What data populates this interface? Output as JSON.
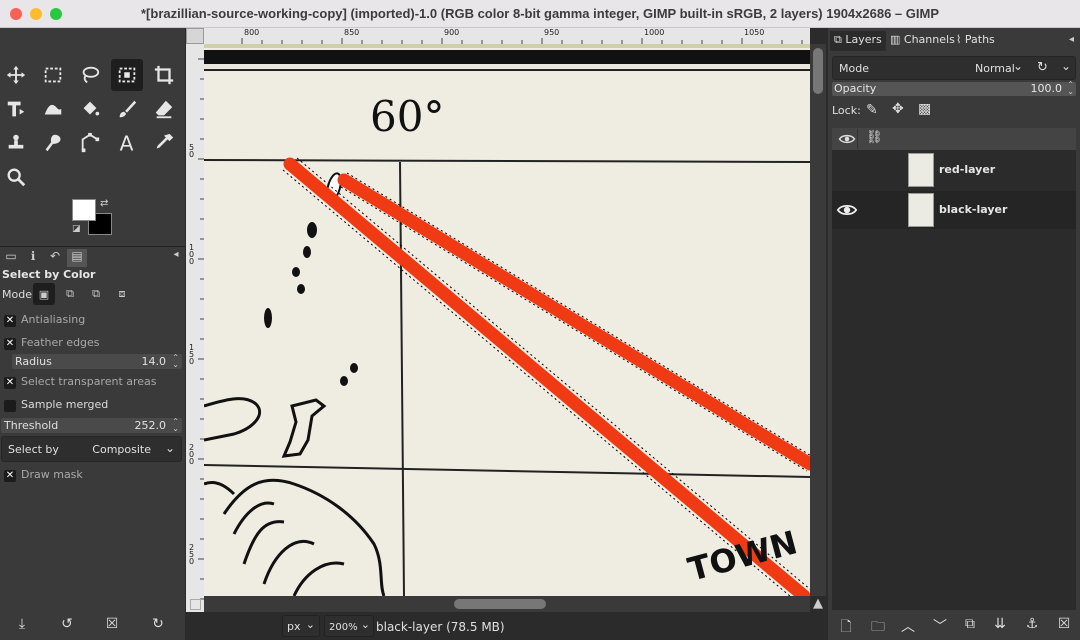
{
  "window": {
    "title": "*[brazillian-source-working-copy] (imported)-1.0 (RGB color 8-bit gamma integer, GIMP built-in sRGB, 2 layers) 1904x2686 – GIMP"
  },
  "tool_options": {
    "title": "Select by Color",
    "mode_label": "Mode:",
    "antialiasing": {
      "label": "Antialiasing",
      "checked": true
    },
    "feather_edges": {
      "label": "Feather edges",
      "checked": true
    },
    "radius": {
      "label": "Radius",
      "value": "14.0"
    },
    "select_transparent": {
      "label": "Select transparent areas",
      "checked": true
    },
    "sample_merged": {
      "label": "Sample merged",
      "checked": false
    },
    "threshold": {
      "label": "Threshold",
      "value": "252.0"
    },
    "select_by": {
      "label": "Select by",
      "value": "Composite"
    },
    "draw_mask": {
      "label": "Draw mask",
      "checked": true
    }
  },
  "ruler": {
    "h_labels": [
      "800",
      "850",
      "900",
      "950",
      "1000",
      "1050"
    ],
    "v_labels": [
      "5 0",
      "1 0 0",
      "1 5 0",
      "2 0 0",
      "2 5 0"
    ]
  },
  "canvas": {
    "map_degree_label": "60°",
    "map_text": "TOWN"
  },
  "statusbar": {
    "unit": "px",
    "zoom": "200%",
    "layer_info": "black-layer (78.5 MB)"
  },
  "layers_dock": {
    "tabs": [
      {
        "label": "Layers"
      },
      {
        "label": "Channels"
      },
      {
        "label": "Paths"
      }
    ],
    "mode_label": "Mode",
    "mode_value": "Normal",
    "opacity_label": "Opacity",
    "opacity_value": "100.0",
    "lock_label": "Lock:",
    "layers": [
      {
        "name": "red-layer",
        "visible": false,
        "selected": false
      },
      {
        "name": "black-layer",
        "visible": true,
        "selected": true
      }
    ]
  }
}
